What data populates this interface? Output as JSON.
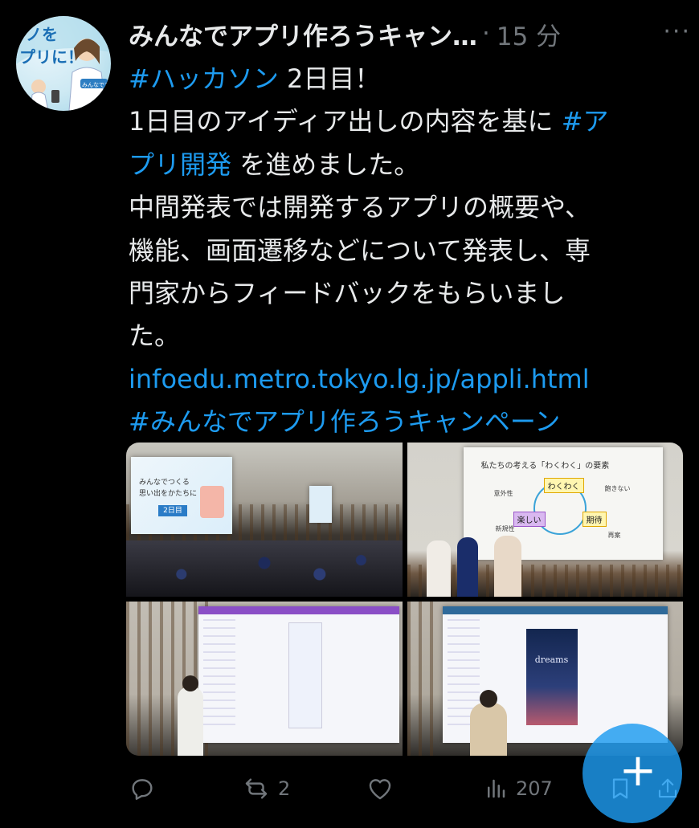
{
  "tweet": {
    "author_name": "みんなでアプリ作ろうキャン…",
    "separator": "·",
    "timestamp": "15 分",
    "more": "···",
    "lines": [
      {
        "parts": [
          {
            "text": "#ハッカソン",
            "link": true
          },
          {
            "text": " 2日目！",
            "link": false
          }
        ]
      },
      {
        "parts": [
          {
            "text": "1日目のアイディア出しの内容を基に ",
            "link": false
          },
          {
            "text": "#ア",
            "link": true
          }
        ]
      },
      {
        "parts": [
          {
            "text": "プリ開発",
            "link": true
          },
          {
            "text": " を進めました。",
            "link": false
          }
        ]
      },
      {
        "parts": [
          {
            "text": "中間発表では開発するアプリの概要や、",
            "link": false
          }
        ]
      },
      {
        "parts": [
          {
            "text": "機能、画面遷移などについて発表し、専",
            "link": false
          }
        ]
      },
      {
        "parts": [
          {
            "text": "門家からフィードバックをもらいまし",
            "link": false
          }
        ]
      },
      {
        "parts": [
          {
            "text": "た。",
            "link": false
          }
        ]
      },
      {
        "parts": [
          {
            "text": "infoedu.metro.tokyo.lg.jp/appli.html",
            "link": true
          }
        ]
      },
      {
        "parts": [
          {
            "text": "#みんなでアプリ作ろうキャンペーン",
            "link": true
          }
        ]
      }
    ],
    "avatar_text": {
      "line1": "ノを",
      "line2": "プリに！",
      "badge": "みんなでアプ"
    },
    "slide1": {
      "line1": "みんなでつくる",
      "line2": "思い出をかたちに",
      "day": "2日目"
    },
    "slide2": {
      "title": "私たちの考える「わくわく」の要素",
      "waku": "わくわく",
      "tanoshii": "楽しい",
      "kitai": "期待",
      "igaisei": "意外性",
      "akinai": "飽きない",
      "shinkisei": "新規性",
      "saiken": "再案"
    },
    "slide4_app_title": "dreams"
  },
  "actions": {
    "reply": {
      "icon": "reply-icon",
      "count": ""
    },
    "retweet": {
      "icon": "retweet-icon",
      "count": "2"
    },
    "like": {
      "icon": "heart-icon",
      "count": ""
    },
    "views": {
      "icon": "views-icon",
      "count": "207"
    },
    "bookmark": {
      "icon": "bookmark-icon"
    },
    "share": {
      "icon": "share-icon"
    }
  },
  "fab": {
    "label": "+"
  },
  "colors": {
    "background": "#000000",
    "text": "#e7e9ea",
    "link": "#1d9bf0",
    "muted": "#71767b"
  }
}
